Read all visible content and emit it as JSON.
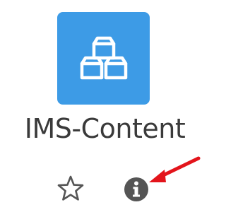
{
  "activity": {
    "icon": "ims-content-boxes-icon",
    "title": "IMS-Content",
    "tile_color": "#3d9be6"
  },
  "actions": {
    "star_icon": "star-outline-icon",
    "info_icon": "info-circle-icon"
  },
  "annotation": {
    "arrow_color": "#e3141b"
  }
}
